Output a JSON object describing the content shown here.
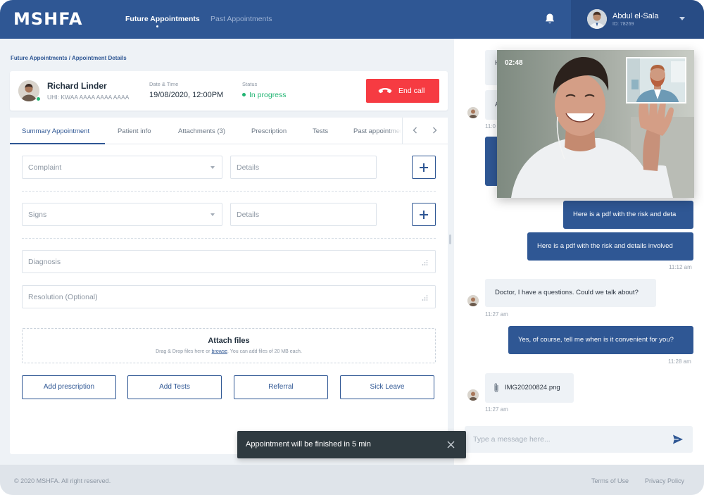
{
  "app": {
    "logo": "MSHFA"
  },
  "nav": {
    "items": [
      {
        "label": "Future Appointments"
      },
      {
        "label": "Past Appointments"
      }
    ]
  },
  "user": {
    "name": "Abdul el-Sala",
    "id": "ID: 78269"
  },
  "breadcrumb": "Future Appointments / Appointment Details",
  "patient": {
    "name": "Richard Linder",
    "uhi": "UHI: KWAA AAAA AAAA AAAA",
    "datetime_label": "Date & Time",
    "datetime_value": "19/08/2020, 12:00PM",
    "status_label": "Status",
    "status_value": "In progress",
    "status_color": "#22b573"
  },
  "end_call": {
    "label": "End call",
    "color": "#f63b42"
  },
  "tabs": [
    {
      "label": "Summary Appointment"
    },
    {
      "label": "Patient info"
    },
    {
      "label": "Attachments (3)"
    },
    {
      "label": "Prescription"
    },
    {
      "label": "Tests"
    },
    {
      "label": "Past appointments"
    }
  ],
  "form": {
    "complaint_placeholder": "Complaint",
    "complaint_details_placeholder": "Details",
    "signs_placeholder": "Signs",
    "signs_details_placeholder": "Details",
    "diagnosis_placeholder": "Diagnosis",
    "resolution_placeholder": "Resolution (Optional)"
  },
  "attach": {
    "title": "Attach files",
    "hint_before": "Drag & Drop files here or ",
    "hint_link": "browse",
    "hint_after": ". You can add files of 20 MB each."
  },
  "actions": [
    {
      "label": "Add prescription"
    },
    {
      "label": "Add Tests"
    },
    {
      "label": "Referral"
    },
    {
      "label": "Sick Leave"
    }
  ],
  "toast": {
    "message": "Appointment will be finished in 5 min"
  },
  "video": {
    "timer": "02:48"
  },
  "chat": {
    "msg1_partial": "H",
    "msg2_partial": "A",
    "ts_partial": "11:0",
    "out1": "Here is a pdf with the risk and deta",
    "out2": "Here is a pdf with the risk and details involved",
    "out2_time": "11:12 am",
    "in3": "Doctor, I have a questions. Could we talk about?",
    "in3_time": "11:27 am",
    "out3": "Yes, of course, tell me when is it convenient for you?",
    "out3_time": "11:28 am",
    "file_name": "IMG20200824.png",
    "file_time": "11:27 am",
    "input_placeholder": "Type a message here..."
  },
  "colors": {
    "primary": "#2f5794",
    "accent_red": "#f63b42",
    "success": "#22b573"
  },
  "footer": {
    "copyright": "© 2020 MSHFA. All right reserved.",
    "terms": "Terms of Use",
    "privacy": "Privacy Policy"
  }
}
